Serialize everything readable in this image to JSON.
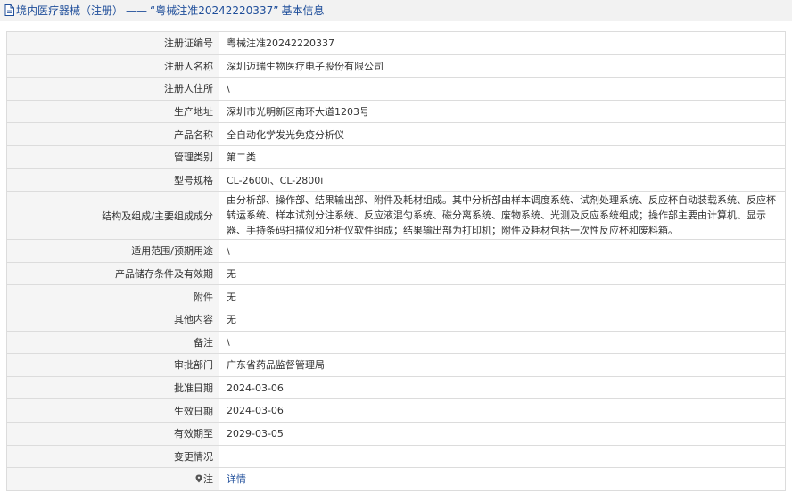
{
  "header": {
    "category": "境内医疗器械（注册）",
    "separator": "——",
    "reg_number_quoted": "“粤械注准20242220337”",
    "suffix": "基本信息"
  },
  "rows": [
    {
      "label": "注册证编号",
      "value": "粤械注准20242220337"
    },
    {
      "label": "注册人名称",
      "value": "深圳迈瑞生物医疗电子股份有限公司"
    },
    {
      "label": "注册人住所",
      "value": "\\"
    },
    {
      "label": "生产地址",
      "value": "深圳市光明新区南环大道1203号"
    },
    {
      "label": "产品名称",
      "value": "全自动化学发光免疫分析仪"
    },
    {
      "label": "管理类别",
      "value": "第二类"
    },
    {
      "label": "型号规格",
      "value": "CL-2600i、CL-2800i"
    },
    {
      "label": "结构及组成/主要组成成分",
      "value": "由分析部、操作部、结果输出部、附件及耗材组成。其中分析部由样本调度系统、试剂处理系统、反应杯自动装载系统、反应杯转运系统、样本试剂分注系统、反应液混匀系统、磁分离系统、废物系统、光测及反应系统组成；操作部主要由计算机、显示器、手持条码扫描仪和分析仪软件组成；结果输出部为打印机；附件及耗材包括一次性反应杯和废料箱。"
    },
    {
      "label": "适用范围/预期用途",
      "value": "\\"
    },
    {
      "label": "产品储存条件及有效期",
      "value": "无"
    },
    {
      "label": "附件",
      "value": "无"
    },
    {
      "label": "其他内容",
      "value": "无"
    },
    {
      "label": "备注",
      "value": "\\"
    },
    {
      "label": "审批部门",
      "value": "广东省药品监督管理局"
    },
    {
      "label": "批准日期",
      "value": "2024-03-06"
    },
    {
      "label": "生效日期",
      "value": "2024-03-06"
    },
    {
      "label": "有效期至",
      "value": "2029-03-05"
    },
    {
      "label": "变更情况",
      "value": ""
    }
  ],
  "note_row": {
    "label": "注",
    "icon": "pin-icon",
    "link": "详情"
  }
}
